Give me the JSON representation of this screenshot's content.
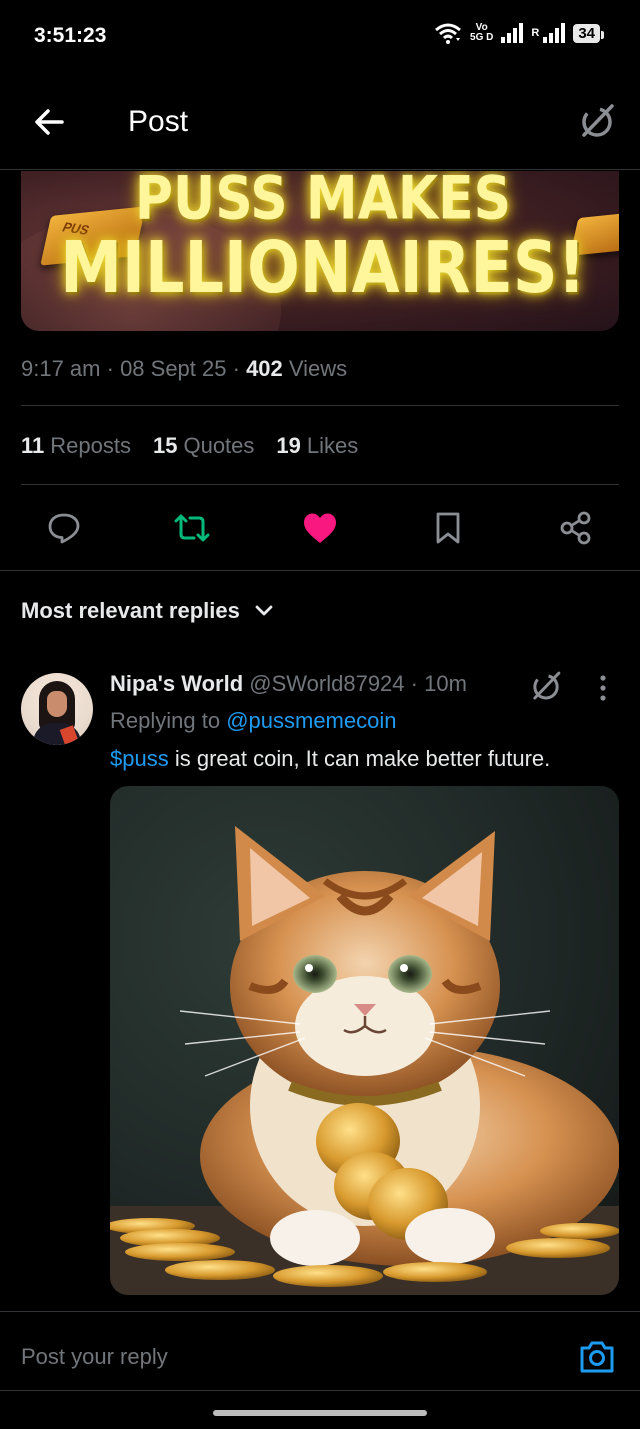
{
  "status_bar": {
    "time": "3:51:23",
    "volte_top": "Vo",
    "volte_bottom": "5G D",
    "roaming": "R",
    "battery": "34",
    "icons": [
      "wifi-icon",
      "signal-icon",
      "signal-icon",
      "battery-icon"
    ]
  },
  "header": {
    "title": "Post",
    "back_icon": "arrow-left-icon",
    "grok_icon": "grok-icon"
  },
  "banner": {
    "line1": "PUSS MAKES",
    "line2": "MILLIONAIRES!",
    "bar_label": "PUS"
  },
  "post_meta": {
    "time": "9:17 am",
    "sep1": " · ",
    "date": "08 Sept 25",
    "sep2": " · ",
    "views_count": "402",
    "views_label": " Views"
  },
  "stats": {
    "reposts_count": "11",
    "reposts_label": "Reposts",
    "quotes_count": "15",
    "quotes_label": "Quotes",
    "likes_count": "19",
    "likes_label": "Likes"
  },
  "actions": {
    "reply_icon": "comment-icon",
    "repost_icon": "repost-icon",
    "like_icon": "heart-icon",
    "bookmark_icon": "bookmark-icon",
    "share_icon": "share-icon",
    "repost_color": "#00ba7c",
    "like_color": "#f91880"
  },
  "replies_filter": {
    "label": "Most relevant replies"
  },
  "reply": {
    "name": "Nipa's World",
    "handle": " @SWorld87924",
    "sep": " · ",
    "time": "10m",
    "replying_prefix": "Replying to ",
    "replying_to": "@pussmemecoin",
    "text_cashtag": "$puss",
    "text_rest": " is great coin, It can make better future."
  },
  "composer": {
    "placeholder": "Post your reply",
    "camera_icon": "camera-icon",
    "accent": "#1d9bf0"
  }
}
